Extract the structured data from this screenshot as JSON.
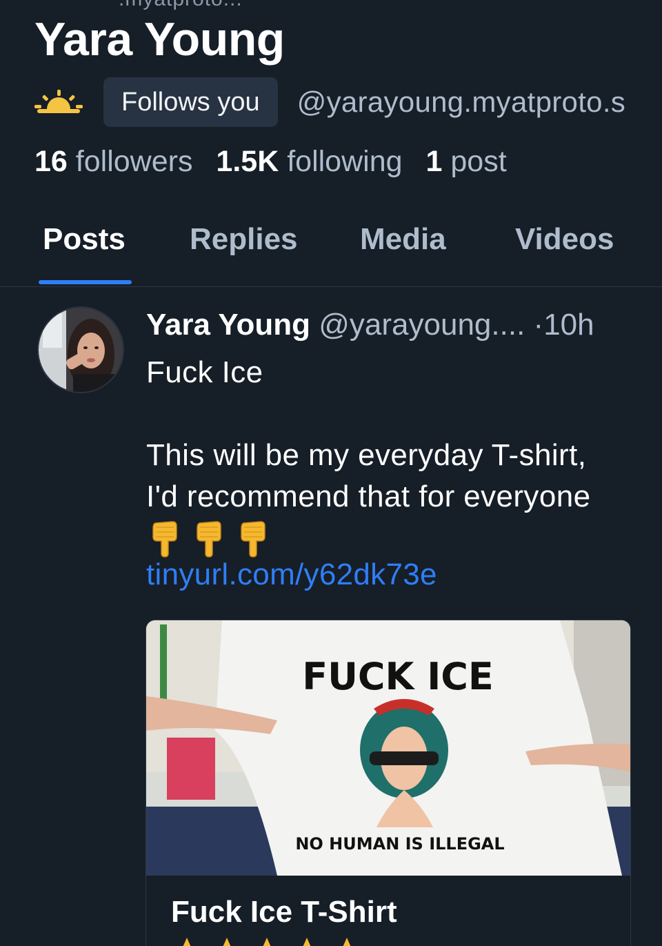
{
  "profile": {
    "top_cut_handle": ".myatproto...",
    "display_name": "Yara Young",
    "follows_you_label": "Follows you",
    "handle": "@yarayoung.myatproto.s",
    "stats": {
      "followers_count": "16",
      "followers_label": "followers",
      "following_count": "1.5K",
      "following_label": "following",
      "posts_count": "1",
      "posts_label": "post"
    }
  },
  "tabs": [
    {
      "label": "Posts",
      "active": true
    },
    {
      "label": "Replies",
      "active": false
    },
    {
      "label": "Media",
      "active": false
    },
    {
      "label": "Videos",
      "active": false
    }
  ],
  "post": {
    "author": "Yara Young",
    "handle": "@yarayoung....",
    "separator": "·",
    "time": "10h",
    "text": "Fuck Ice\n\nThis will be my everyday T-shirt,\nI'd recommend that for everyone",
    "emoji_icons": [
      "backhand-index-pointing-down-icon",
      "backhand-index-pointing-down-icon",
      "backhand-index-pointing-down-icon"
    ],
    "link": "tinyurl.com/y62dk73e",
    "card": {
      "image_text_top": "FUCK ICE",
      "image_text_bottom": "NO HUMAN IS ILLEGAL",
      "title": "Fuck Ice T-Shirt",
      "star_icons": [
        "star-icon",
        "star-icon",
        "star-icon",
        "star-icon",
        "star-icon"
      ]
    }
  },
  "colors": {
    "background": "#161e27",
    "accent": "#2f7ef6",
    "muted_text": "#aebccc",
    "badge_bg": "#273242",
    "sun": "#f5c443"
  }
}
